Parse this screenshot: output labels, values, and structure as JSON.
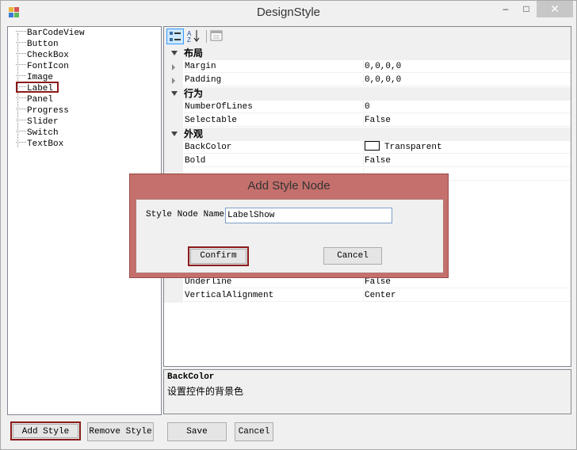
{
  "window": {
    "title": "DesignStyle",
    "minimize_glyph": "–",
    "maximize_glyph": "□",
    "close_glyph": "✕"
  },
  "tree": {
    "items": [
      "BarCodeView",
      "Button",
      "CheckBox",
      "FontIcon",
      "Image",
      "Label",
      "Panel",
      "Progress",
      "Slider",
      "Switch",
      "TextBox"
    ],
    "selected": "Label"
  },
  "property_grid": {
    "categories": [
      {
        "label": "布局",
        "rows": [
          {
            "name": "Margin",
            "value": "0,0,0,0",
            "expandable": true
          },
          {
            "name": "Padding",
            "value": "0,0,0,0",
            "expandable": true
          }
        ]
      },
      {
        "label": "行为",
        "rows": [
          {
            "name": "NumberOfLines",
            "value": "0"
          },
          {
            "name": "Selectable",
            "value": "False"
          }
        ]
      },
      {
        "label": "外观",
        "rows": [
          {
            "name": "BackColor",
            "value": "Transparent",
            "swatch": true
          },
          {
            "name": "Bold",
            "value": "False"
          }
        ]
      }
    ],
    "hidden_rows": [
      {
        "name": "Underline",
        "value": "False"
      },
      {
        "name": "VerticalAlignment",
        "value": "Center"
      }
    ]
  },
  "description": {
    "title": "BackColor",
    "text": "设置控件的背景色"
  },
  "buttons": {
    "add_style": "Add Style",
    "remove_style": "Remove Style",
    "save": "Save",
    "cancel": "Cancel"
  },
  "modal": {
    "title": "Add Style Node",
    "field_label": "Style Node Name",
    "field_value": "LabelShow",
    "confirm": "Confirm",
    "cancel": "Cancel"
  },
  "colors": {
    "highlight_border": "#8b1a1a",
    "modal_frame": "#c5706c",
    "toolbar_active": "#cce8ff"
  }
}
